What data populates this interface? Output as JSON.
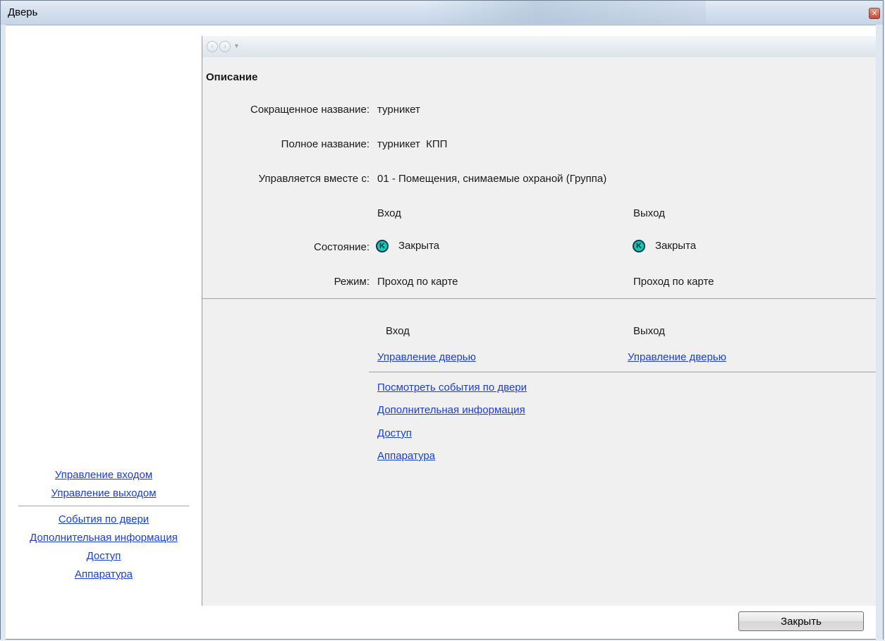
{
  "window": {
    "title": "Дверь",
    "close_icon": "close-icon"
  },
  "nav": {
    "back_icon": "back-arrow-icon",
    "forward_icon": "forward-arrow-icon",
    "dropdown_icon": "chevron-down-icon"
  },
  "description": {
    "heading": "Описание",
    "short_name_label": "Сокращенное название:",
    "short_name_value": "турникет",
    "full_name_label": "Полное название:",
    "full_name_value": "турникет  КПП",
    "managed_with_label": "Управляется вместе с:",
    "managed_with_value": "01 - Помещения, снимаемые охраной (Группа)",
    "entry_header": "Вход",
    "exit_header": "Выход",
    "state_label": "Состояние:",
    "state_icon_letter": "K",
    "entry_state": "Закрыта",
    "exit_state": "Закрыта",
    "mode_label": "Режим:",
    "entry_mode": "Проход по карте",
    "exit_mode": "Проход по карте"
  },
  "actions": {
    "entry_header": "Вход",
    "exit_header": "Выход",
    "entry_door_control": "Управление дверью",
    "exit_door_control": "Управление дверью",
    "links": [
      "Посмотреть события по двери",
      "Дополнительная информация",
      "Доступ",
      "Аппаратура"
    ]
  },
  "sidebar": {
    "control_links": [
      "Управление входом",
      "Управление выходом"
    ],
    "info_links": [
      "События по двери",
      "Дополнительная информация",
      "Доступ",
      "Аппаратура"
    ]
  },
  "footer": {
    "close_label": "Закрыть"
  },
  "colors": {
    "link": "#1a3fd6",
    "state_icon": "#19c9a9",
    "panel_bg": "#f0f0f0"
  }
}
